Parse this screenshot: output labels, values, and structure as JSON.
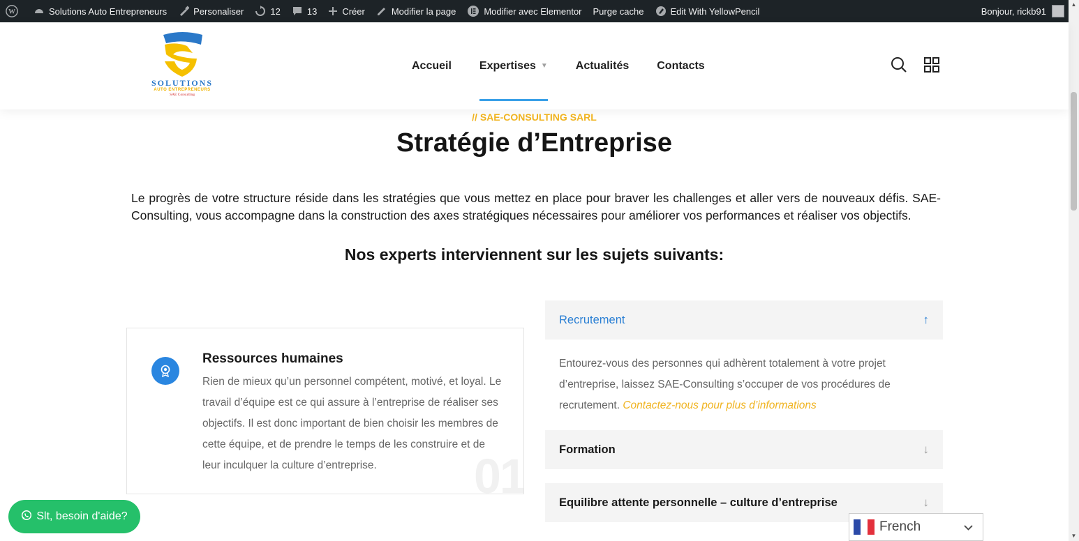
{
  "adminbar": {
    "site_name": "Solutions Auto Entrepreneurs",
    "customize": "Personaliser",
    "updates": "12",
    "comments": "13",
    "new": "Créer",
    "edit_page": "Modifier la page",
    "elementor": "Modifier avec Elementor",
    "purge": "Purge cache",
    "yellowpencil": "Edit With YellowPencil",
    "greeting": "Bonjour, rickb91"
  },
  "logo": {
    "title": "SOLUTIONS",
    "subtitle": "AUTO ENTREPRENEURS",
    "tagline": "SAE Consulting",
    "colors": {
      "blue": "#2a78c8",
      "yellow": "#f5c000"
    }
  },
  "nav": {
    "items": [
      "Accueil",
      "Expertises",
      "Actualités",
      "Contacts"
    ],
    "active": "Expertises"
  },
  "page": {
    "eyebrow": "// SAE-CONSULTING SARL",
    "title": "Stratégie d’Entreprise",
    "intro": "Le progrès de votre structure réside dans les stratégies que vous mettez en place pour braver les challenges et aller vers de nouveaux défis. SAE-Consulting, vous accompagne dans la construction des axes stratégiques nécessaires pour améliorer vos performances et réaliser vos objectifs.",
    "subheading": "Nos experts interviennent sur les sujets suivants:"
  },
  "card": {
    "title": "Ressources humaines",
    "text": "Rien de mieux qu’un personnel compétent, motivé, et loyal. Le travail d’équipe est ce qui assure à l’entreprise de réaliser ses objectifs. Il est donc important de bien choisir les membres de cette équipe, et de prendre le temps de les construire et de leur inculquer la culture d’entreprise.",
    "number": "01",
    "icon": "award-icon"
  },
  "accordion": [
    {
      "title": "Recrutement",
      "open": true,
      "body": "Entourez-vous des personnes qui adhèrent totalement à votre projet d’entreprise, laissez SAE-Consulting s’occuper de vos procédures de recrutement.",
      "link": "Contactez-nous pour plus d’informations"
    },
    {
      "title": "Formation",
      "open": false
    },
    {
      "title": "Equilibre attente personnelle – culture d’entreprise",
      "open": false
    }
  ],
  "widgets": {
    "whatsapp_label": "Slt, besoin d'aide?",
    "language": "French"
  },
  "colors": {
    "accent_blue": "#2a86e0",
    "accent_yellow": "#f0b31f",
    "whatsapp_green": "#25c06a",
    "adminbar": "#1d2327"
  }
}
